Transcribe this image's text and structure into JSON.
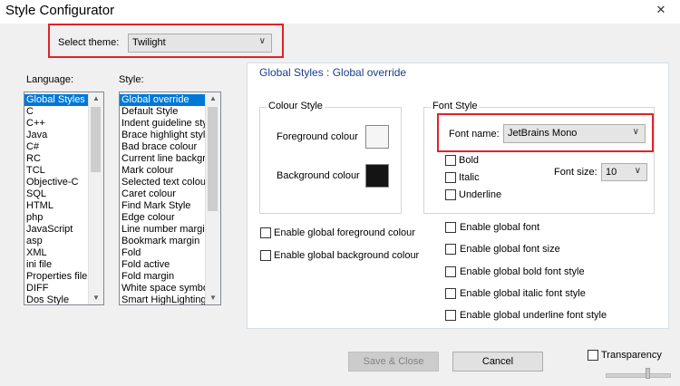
{
  "window": {
    "title": "Style Configurator",
    "close_icon": "close-icon"
  },
  "theme": {
    "label": "Select theme:",
    "value": "Twilight"
  },
  "language": {
    "label": "Language:",
    "items": [
      "Global Styles",
      "C",
      "C++",
      "Java",
      "C#",
      "RC",
      "TCL",
      "Objective-C",
      "SQL",
      "HTML",
      "php",
      "JavaScript",
      "asp",
      "XML",
      "ini file",
      "Properties file",
      "DIFF",
      "Dos Style"
    ]
  },
  "style": {
    "label": "Style:",
    "items": [
      "Global override",
      "Default Style",
      "Indent guideline sty",
      "Brace highlight style",
      "Bad brace colour",
      "Current line backgr",
      "Mark colour",
      "Selected text colou",
      "Caret colour",
      "Find Mark Style",
      "Edge colour",
      "Line number margin",
      "Bookmark margin",
      "Fold",
      "Fold active",
      "Fold margin",
      "White space symbo",
      "Smart HighLighting"
    ]
  },
  "panel": {
    "heading": "Global Styles : Global override",
    "colour_style": {
      "legend": "Colour Style",
      "foreground_label": "Foreground colour",
      "background_label": "Background colour",
      "foreground_color": "#f5f5f5",
      "background_color": "#141414"
    },
    "font_style": {
      "legend": "Font Style",
      "font_name_label": "Font name:",
      "font_name_value": "JetBrains Mono",
      "bold": "Bold",
      "italic": "Italic",
      "underline": "Underline",
      "font_size_label": "Font size:",
      "font_size_value": "10"
    },
    "enable_fg": "Enable global foreground colour",
    "enable_bg": "Enable global background colour",
    "enable_font": "Enable global font",
    "enable_font_size": "Enable global font size",
    "enable_bold": "Enable global bold font style",
    "enable_italic": "Enable global italic font style",
    "enable_underline": "Enable global underline font style"
  },
  "buttons": {
    "save_close": "Save & Close",
    "cancel": "Cancel"
  },
  "transparency": {
    "label": "Transparency"
  },
  "colors": {
    "highlight": "#e0222a",
    "selection": "#0078d7",
    "heading_text": "#1a3d8f"
  }
}
